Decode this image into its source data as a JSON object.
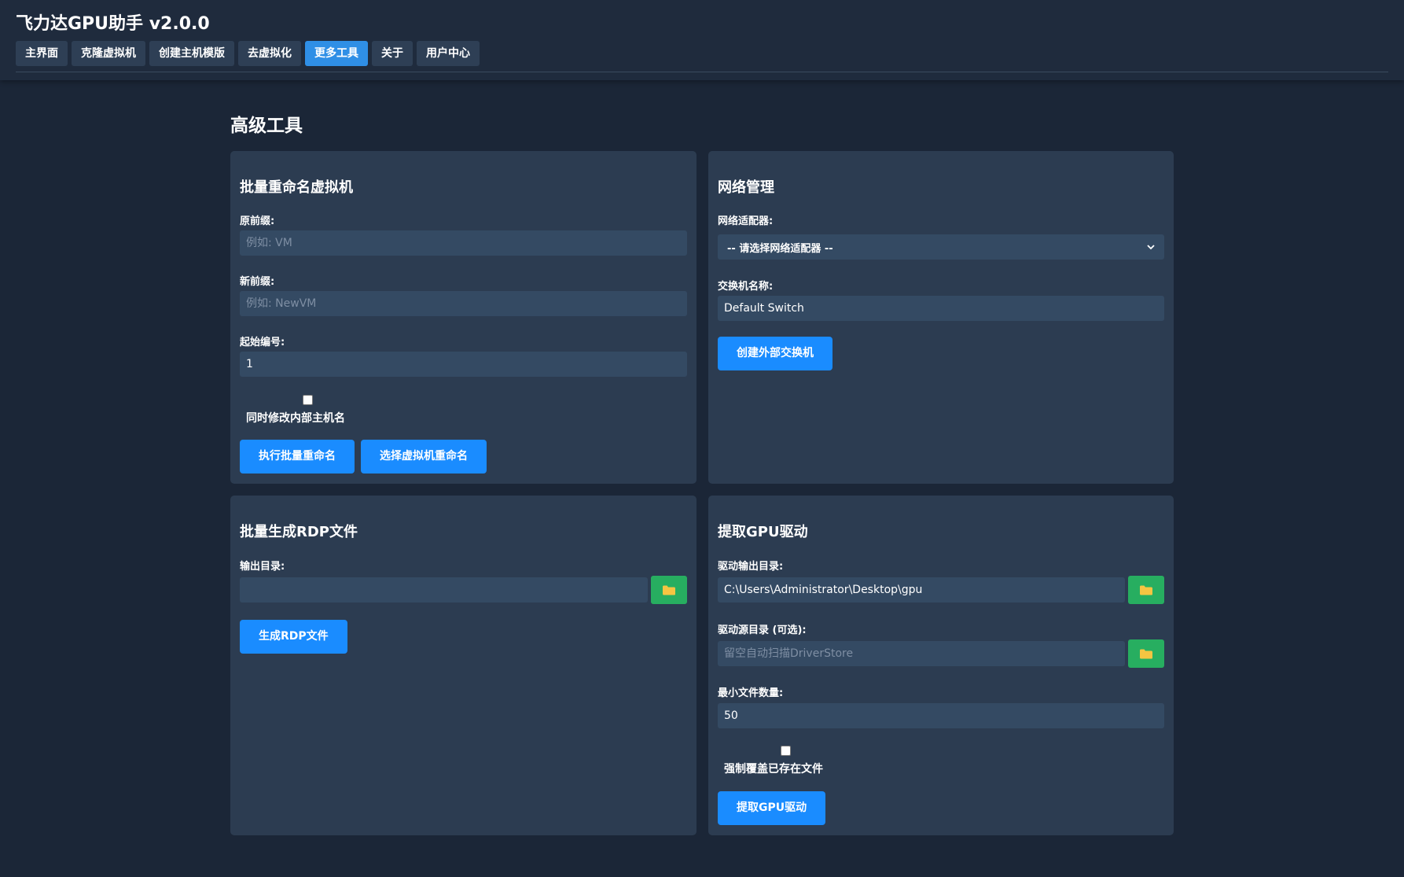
{
  "app": {
    "title": "飞力达GPU助手 v2.0.0"
  },
  "tabs": [
    {
      "label": "主界面",
      "active": false
    },
    {
      "label": "克隆虚拟机",
      "active": false
    },
    {
      "label": "创建主机模版",
      "active": false
    },
    {
      "label": "去虚拟化",
      "active": false
    },
    {
      "label": "更多工具",
      "active": true
    },
    {
      "label": "关于",
      "active": false
    },
    {
      "label": "用户中心",
      "active": false
    }
  ],
  "section": {
    "title": "高级工具"
  },
  "rename": {
    "title": "批量重命名虚拟机",
    "old_prefix_label": "原前缀:",
    "old_prefix_placeholder": "例如: VM",
    "new_prefix_label": "新前缀:",
    "new_prefix_placeholder": "例如: NewVM",
    "start_label": "起始编号:",
    "start_value": "1",
    "hostname_label": "同时修改内部主机名",
    "hostname_checked": false,
    "run_button": "执行批量重命名",
    "select_button": "选择虚拟机重命名"
  },
  "network": {
    "title": "网络管理",
    "adapter_label": "网络适配器:",
    "adapter_selected": "-- 请选择网络适配器 --",
    "switch_label": "交换机名称:",
    "switch_value": "Default Switch",
    "create_button": "创建外部交换机"
  },
  "rdp": {
    "title": "批量生成RDP文件",
    "output_label": "输出目录:",
    "output_value": "",
    "generate_button": "生成RDP文件"
  },
  "gpu": {
    "title": "提取GPU驱动",
    "output_label": "驱动输出目录:",
    "output_value": "C:\\Users\\Administrator\\Desktop\\gpu",
    "source_label": "驱动源目录 (可选):",
    "source_placeholder": "留空自动扫描DriverStore",
    "min_label": "最小文件数量:",
    "min_value": "50",
    "force_label": "强制覆盖已存在文件",
    "force_checked": false,
    "extract_button": "提取GPU驱动"
  },
  "colors": {
    "background": "#1b2637",
    "card": "#2c3c51",
    "input": "#344a63",
    "primary_button": "#1a8cff",
    "active_tab": "#2f8fe6",
    "folder_button": "#27ae60",
    "folder_icon": "#f5c542"
  },
  "icons": {
    "folder": "folder-icon",
    "dropdown": "chevron-down-icon"
  }
}
